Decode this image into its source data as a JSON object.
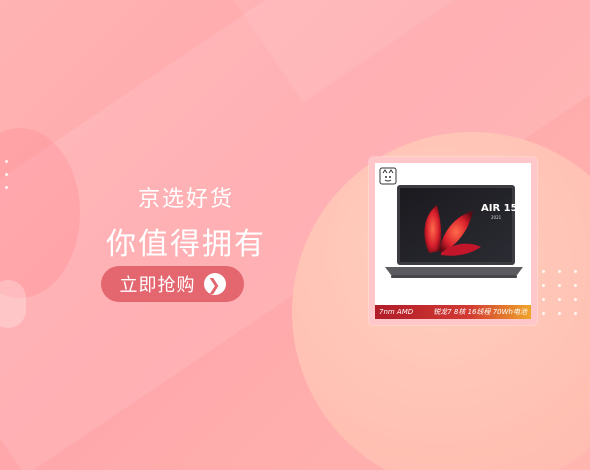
{
  "banner": {
    "headline_line1": "京选好货",
    "headline_line2": "你值得拥有",
    "cta_label": "立即抢购",
    "cta_arrow": "❯"
  },
  "product": {
    "model_badge": "AIR 15",
    "model_year": "2021",
    "spec_left": "7nm AMD",
    "spec_right": "锐龙7  8核  16线程  70Wh电池"
  },
  "colors": {
    "background": "#ffb3b3",
    "button": "#e4666f",
    "spec_bar_start": "#b01c28",
    "spec_bar_end": "#f0a52a"
  },
  "icons": {
    "store_logo": "jd-dog-logo-icon",
    "cta_arrow": "chevron-right-icon"
  }
}
